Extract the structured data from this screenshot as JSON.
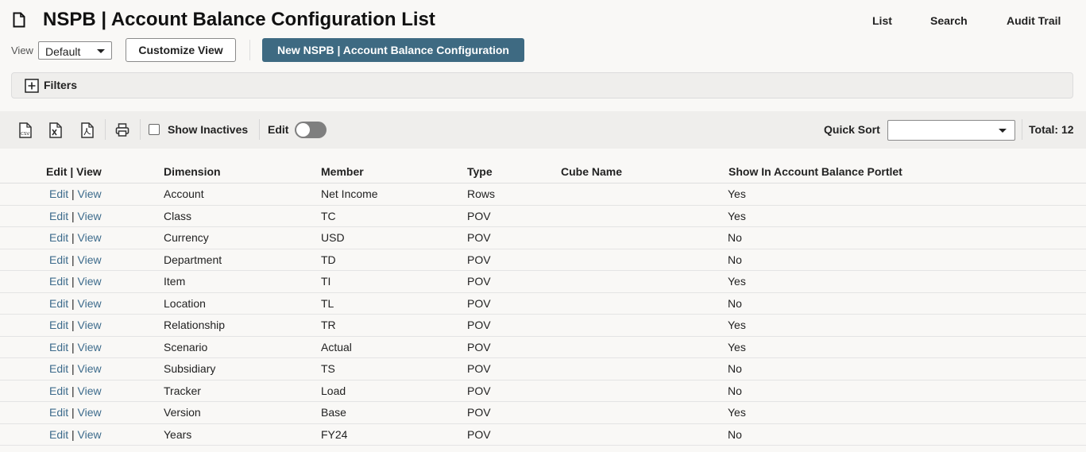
{
  "header": {
    "title": "NSPB | Account Balance Configuration List",
    "nav": [
      "List",
      "Search",
      "Audit Trail"
    ]
  },
  "view": {
    "label": "View",
    "selected": "Default",
    "customize_label": "Customize View",
    "new_label": "New NSPB | Account Balance Configuration"
  },
  "filters": {
    "label": "Filters"
  },
  "toolbar": {
    "icons": [
      "export-csv-icon",
      "export-excel-icon",
      "export-pdf-icon",
      "print-icon"
    ],
    "show_inactives_label": "Show Inactives",
    "edit_label": "Edit",
    "quick_sort_label": "Quick Sort",
    "quick_sort_value": "",
    "total_label": "Total: 12"
  },
  "table": {
    "columns": [
      "Edit | View",
      "Dimension",
      "Member",
      "Type",
      "Cube Name",
      "Show In Account Balance Portlet"
    ],
    "edit_link": "Edit",
    "view_link": "View",
    "rows": [
      {
        "dimension": "Account",
        "member": "Net Income",
        "type": "Rows",
        "cube": "",
        "portlet": "Yes"
      },
      {
        "dimension": "Class",
        "member": "TC",
        "type": "POV",
        "cube": "",
        "portlet": "Yes"
      },
      {
        "dimension": "Currency",
        "member": "USD",
        "type": "POV",
        "cube": "",
        "portlet": "No"
      },
      {
        "dimension": "Department",
        "member": "TD",
        "type": "POV",
        "cube": "",
        "portlet": "No"
      },
      {
        "dimension": "Item",
        "member": "TI",
        "type": "POV",
        "cube": "",
        "portlet": "Yes"
      },
      {
        "dimension": "Location",
        "member": "TL",
        "type": "POV",
        "cube": "",
        "portlet": "No"
      },
      {
        "dimension": "Relationship",
        "member": "TR",
        "type": "POV",
        "cube": "",
        "portlet": "Yes"
      },
      {
        "dimension": "Scenario",
        "member": "Actual",
        "type": "POV",
        "cube": "",
        "portlet": "Yes"
      },
      {
        "dimension": "Subsidiary",
        "member": "TS",
        "type": "POV",
        "cube": "",
        "portlet": "No"
      },
      {
        "dimension": "Tracker",
        "member": "Load",
        "type": "POV",
        "cube": "",
        "portlet": "No"
      },
      {
        "dimension": "Version",
        "member": "Base",
        "type": "POV",
        "cube": "",
        "portlet": "Yes"
      },
      {
        "dimension": "Years",
        "member": "FY24",
        "type": "POV",
        "cube": "",
        "portlet": "No"
      }
    ]
  },
  "colors": {
    "primary_button": "#3e6a82",
    "link": "#3d6b8c",
    "toolbar_bg": "#efeeec"
  }
}
